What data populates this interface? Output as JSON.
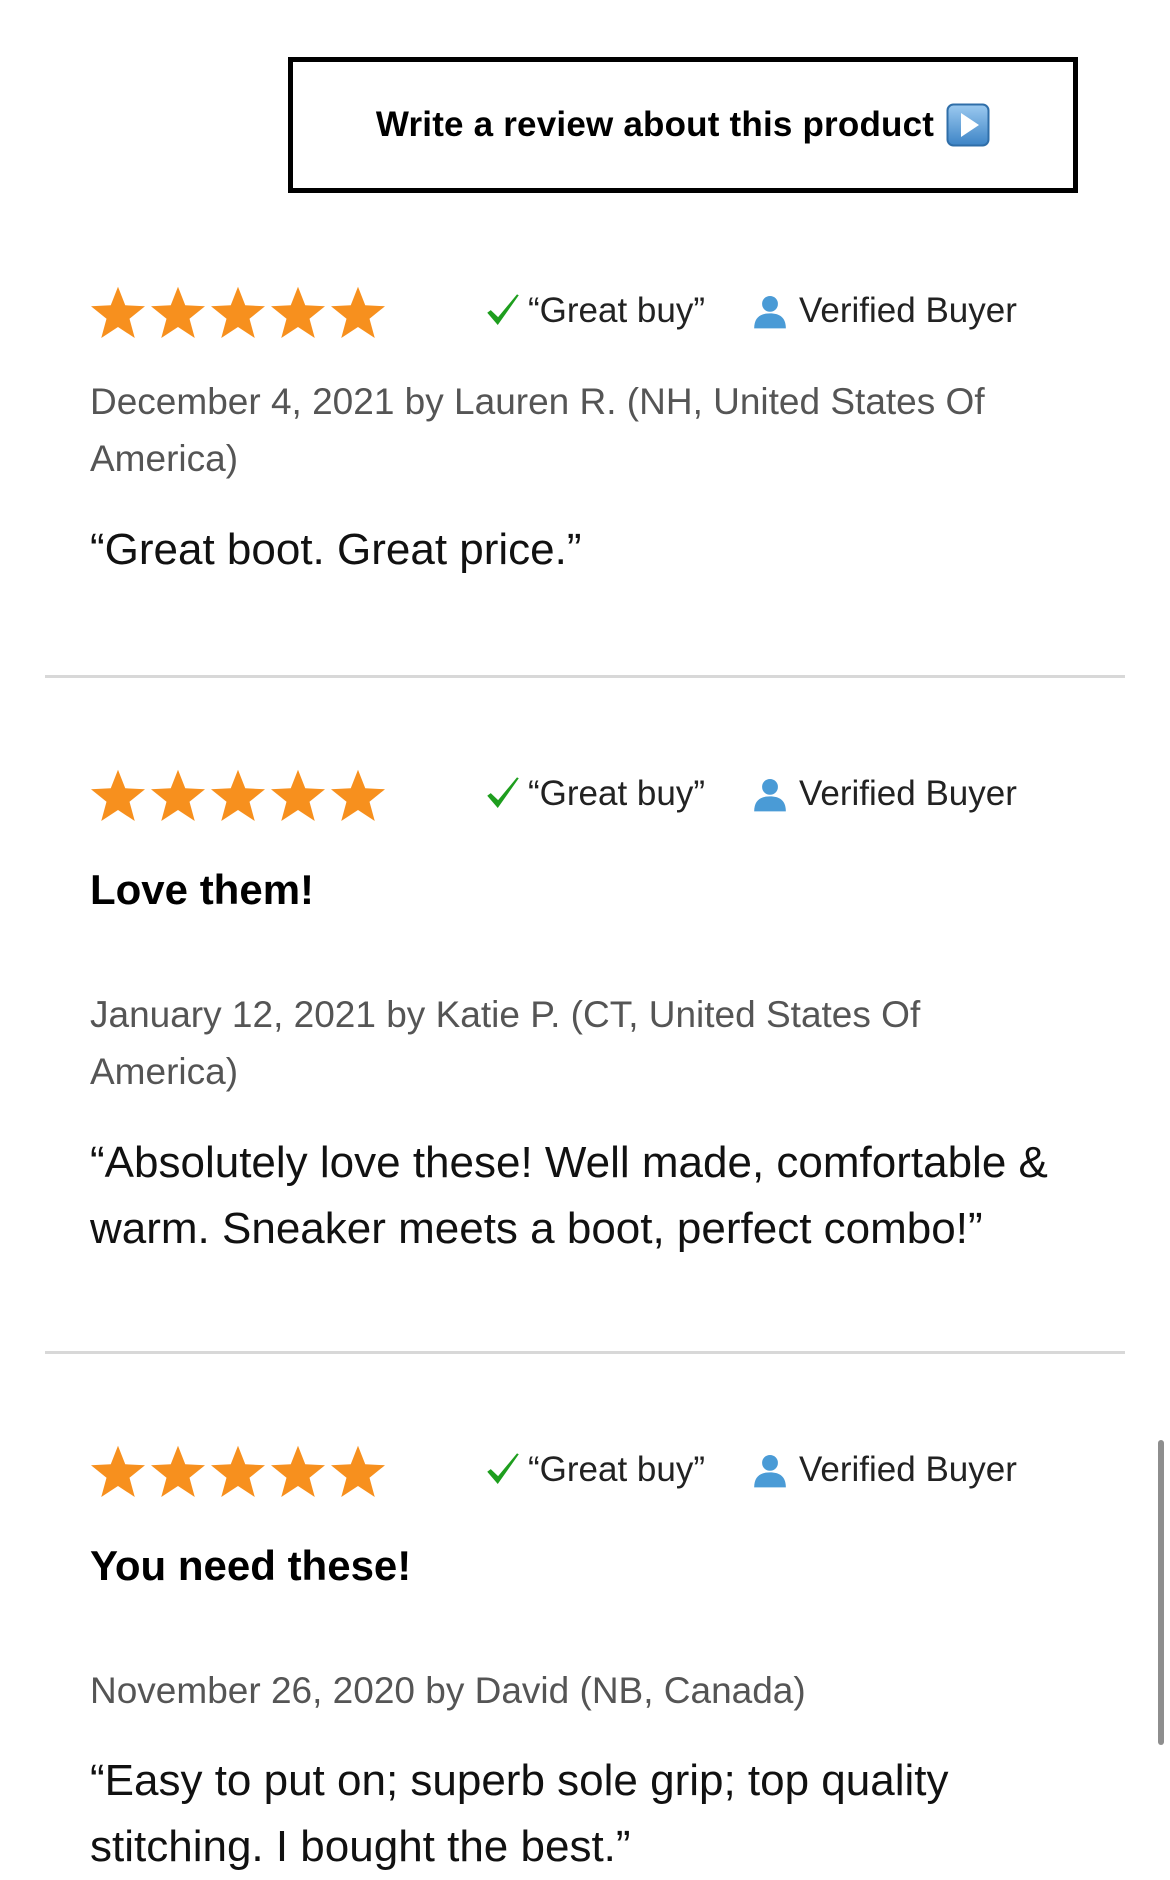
{
  "write_review": {
    "label": "Write a review about this product"
  },
  "colors": {
    "star": "#F7901E",
    "check": "#1E9E1E",
    "user_icon": "#4A9BD6",
    "byline": "#555555",
    "divider": "#D8D8D8"
  },
  "icons": {
    "star": "star-icon",
    "check": "checkmark-icon",
    "user": "user-icon",
    "play": "play-icon"
  },
  "reviews": [
    {
      "rating": 5,
      "great_buy": "“Great buy”",
      "verified": "Verified Buyer",
      "headline": "",
      "byline": "December 4, 2021 by Lauren R. (NH, United States Of America)",
      "text": "“Great boot. Great price.”"
    },
    {
      "rating": 5,
      "great_buy": "“Great buy”",
      "verified": "Verified Buyer",
      "headline": "Love them!",
      "byline": "January 12, 2021 by Katie P. (CT, United States Of America)",
      "text": "“Absolutely love these! Well made, comfortable & warm. Sneaker meets a boot, perfect combo!”"
    },
    {
      "rating": 5,
      "great_buy": "“Great buy”",
      "verified": "Verified Buyer",
      "headline": "You need these!",
      "byline": "November 26, 2020 by David (NB, Canada)",
      "text": "“Easy to put on; superb sole grip; top quality stitching. I bought the best.”"
    }
  ]
}
